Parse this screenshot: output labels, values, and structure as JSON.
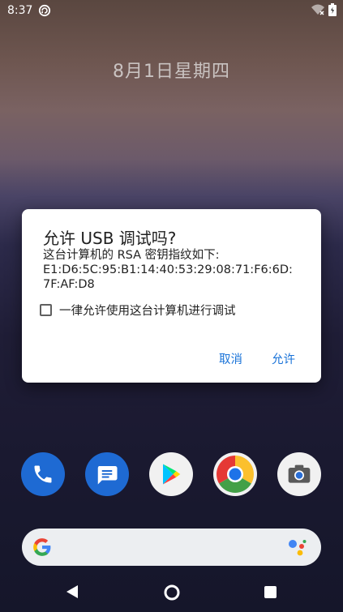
{
  "status_bar": {
    "time": "8:37"
  },
  "lock_screen": {
    "date": "8月1日星期四"
  },
  "dialog": {
    "title": "允许 USB 调试吗?",
    "message_lines": [
      "这台计算机的 RSA 密钥指纹如下:",
      "E1:D6:5C:95:B1:14:40:53:29:08:71:F6:6D:",
      "7F:AF:D8"
    ],
    "checkbox_label": "一律允许使用这台计算机进行调试",
    "checkbox_checked": false,
    "cancel_label": "取消",
    "allow_label": "允许",
    "accent_color": "#1a73d8"
  },
  "dock_apps": [
    "phone-icon",
    "messages-icon",
    "play-store-icon",
    "chrome-icon",
    "camera-icon"
  ],
  "search_bar": {
    "left_icon": "google-g-icon",
    "right_icon": "assistant-icon"
  },
  "nav_bar": {
    "buttons": [
      "back-icon",
      "home-icon",
      "recents-icon"
    ]
  }
}
